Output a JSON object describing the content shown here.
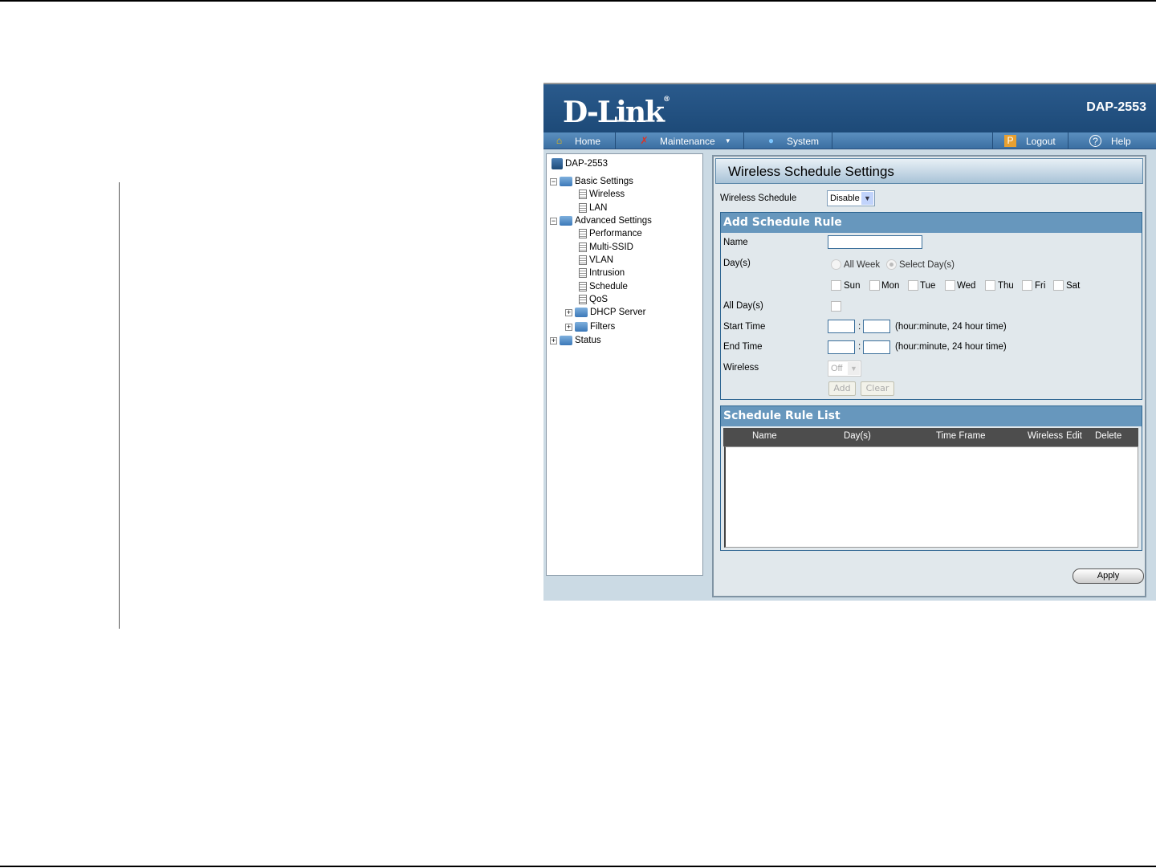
{
  "header": {
    "logo": "D-Link",
    "model": "DAP-2553"
  },
  "nav": {
    "home": "Home",
    "maintenance": "Maintenance",
    "system": "System",
    "logout": "Logout",
    "help": "Help"
  },
  "tree": {
    "root": "DAP-2553",
    "basic": "Basic Settings",
    "wireless": "Wireless",
    "lan": "LAN",
    "advanced": "Advanced Settings",
    "performance": "Performance",
    "multissid": "Multi-SSID",
    "vlan": "VLAN",
    "intrusion": "Intrusion",
    "schedule": "Schedule",
    "qos": "QoS",
    "dhcp": "DHCP Server",
    "filters": "Filters",
    "status": "Status"
  },
  "main": {
    "title": "Wireless Schedule Settings",
    "schedule_label": "Wireless Schedule",
    "schedule_value": "Disable",
    "add_rule": {
      "header": "Add Schedule Rule",
      "name_label": "Name",
      "name_value": "",
      "days_label": "Day(s)",
      "all_week": "All Week",
      "select_days": "Select Day(s)",
      "selected_radio": "Select Day(s)",
      "days": [
        "Sun",
        "Mon",
        "Tue",
        "Wed",
        "Thu",
        "Fri",
        "Sat"
      ],
      "all_days_label": "All Day(s)",
      "start_label": "Start Time",
      "end_label": "End Time",
      "colon": ":",
      "time_hint": "(hour:minute, 24 hour time)",
      "wireless_label": "Wireless",
      "wireless_value": "Off",
      "add": "Add",
      "clear": "Clear"
    },
    "rule_list": {
      "header": "Schedule Rule List",
      "columns": [
        "Name",
        "Day(s)",
        "Time Frame",
        "Wireless",
        "Edit",
        "Delete"
      ]
    },
    "apply": "Apply"
  }
}
